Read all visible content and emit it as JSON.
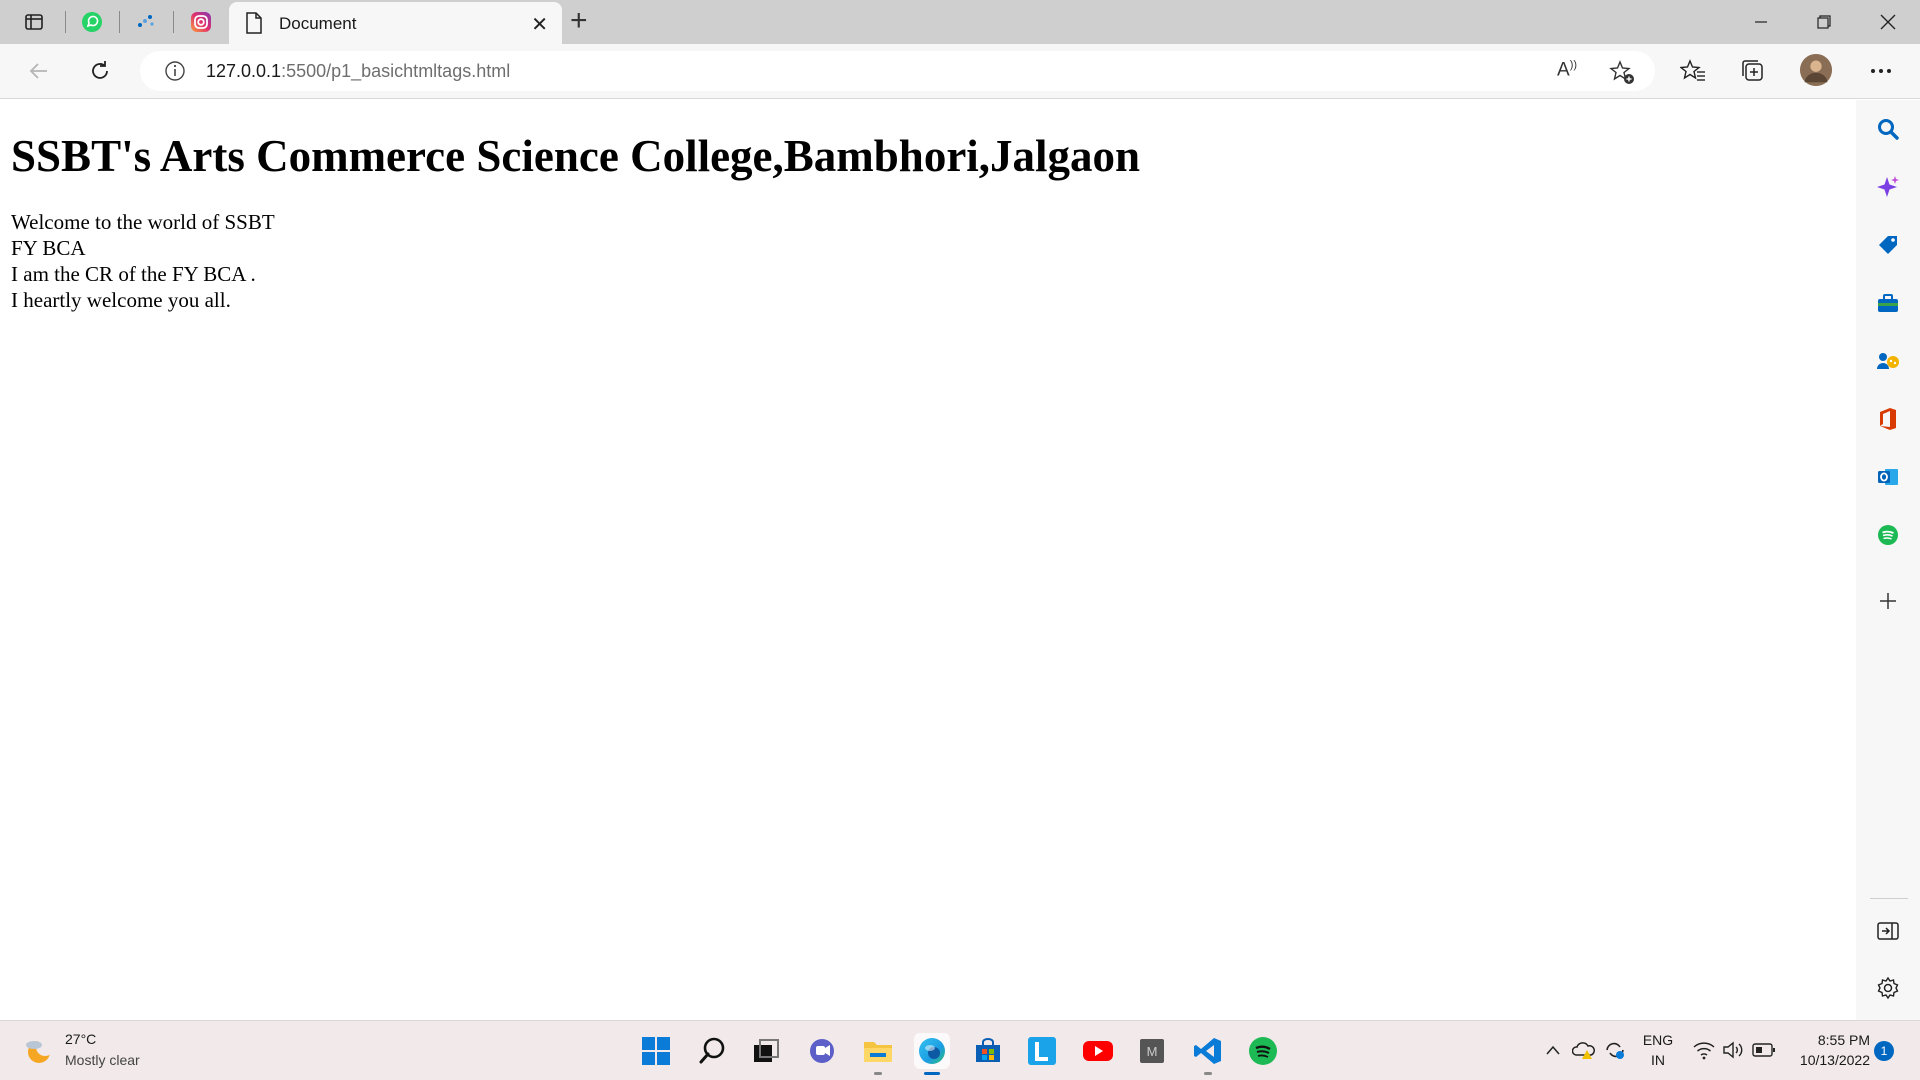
{
  "browser": {
    "tab": {
      "title": "Document"
    },
    "address": {
      "host": "127.0.0.1",
      "rest": ":5500/p1_basichtmltags.html"
    }
  },
  "page": {
    "heading": "SSBT's Arts Commerce Science College,Bambhori,Jalgaon",
    "lines": [
      "Welcome to the world of SSBT",
      "FY BCA",
      "I am the CR of the FY BCA .",
      "I heartly welcome you all."
    ]
  },
  "taskbar": {
    "weather": {
      "temp": "27°C",
      "desc": "Mostly clear"
    },
    "lang": {
      "line1": "ENG",
      "line2": "IN"
    },
    "clock": {
      "time": "8:55 PM",
      "date": "10/13/2022"
    },
    "notifications": "1"
  },
  "colors": {
    "edge_blue": "#0067c0",
    "whatsapp": "#25d366",
    "spotify": "#1db954",
    "youtube": "#ff0000",
    "office": "#d83b01"
  }
}
